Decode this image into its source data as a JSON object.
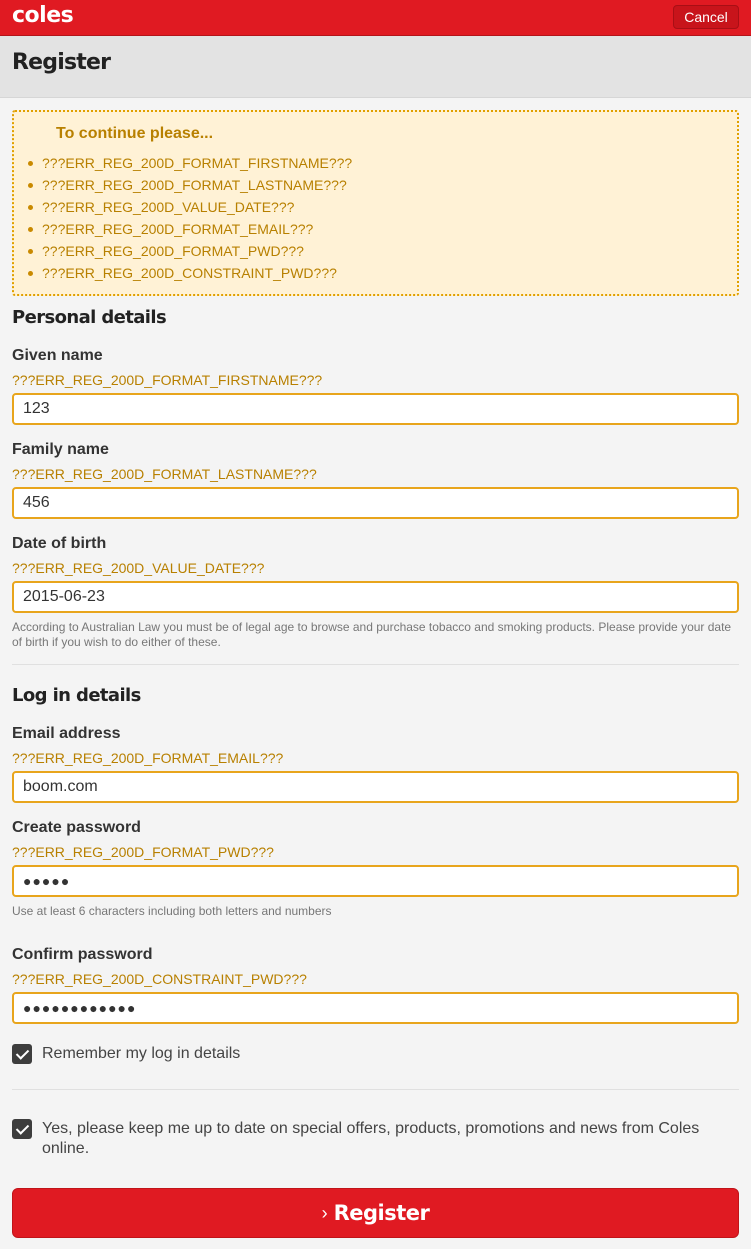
{
  "header": {
    "logo": "coles",
    "cancel_label": "Cancel"
  },
  "page": {
    "title": "Register"
  },
  "error_summary": {
    "title": "To continue please...",
    "items": [
      "???ERR_REG_200D_FORMAT_FIRSTNAME???",
      "???ERR_REG_200D_FORMAT_LASTNAME???",
      "???ERR_REG_200D_VALUE_DATE???",
      "???ERR_REG_200D_FORMAT_EMAIL???",
      "???ERR_REG_200D_FORMAT_PWD???",
      "???ERR_REG_200D_CONSTRAINT_PWD???"
    ]
  },
  "personal": {
    "title": "Personal details",
    "given_name": {
      "label": "Given name",
      "error": "???ERR_REG_200D_FORMAT_FIRSTNAME???",
      "value": "123"
    },
    "family_name": {
      "label": "Family name",
      "error": "???ERR_REG_200D_FORMAT_LASTNAME???",
      "value": "456"
    },
    "dob": {
      "label": "Date of birth",
      "error": "???ERR_REG_200D_VALUE_DATE???",
      "value": "2015-06-23",
      "help": "According to Australian Law you must be of legal age to browse and purchase tobacco and smoking products. Please provide your date of birth if you wish to do either of these."
    }
  },
  "login": {
    "title": "Log in details",
    "email": {
      "label": "Email address",
      "error": "???ERR_REG_200D_FORMAT_EMAIL???",
      "value": "boom.com"
    },
    "password": {
      "label": "Create password",
      "error": "???ERR_REG_200D_FORMAT_PWD???",
      "value": "●●●●●",
      "help": "Use at least 6 characters including both letters and numbers"
    },
    "confirm": {
      "label": "Confirm password",
      "error": "???ERR_REG_200D_CONSTRAINT_PWD???",
      "value": "●●●●●●●●●●●●"
    },
    "remember": {
      "label": "Remember my log in details",
      "checked": true
    }
  },
  "marketing": {
    "label": "Yes, please keep me up to date on special offers, products, promotions and news from Coles online.",
    "checked": true
  },
  "submit": {
    "chevron": "›",
    "label": "Register"
  },
  "colors": {
    "brand_red": "#e01a22",
    "error_amber": "#b88000",
    "error_bg": "#fff2d6",
    "input_border": "#e8a51c"
  }
}
